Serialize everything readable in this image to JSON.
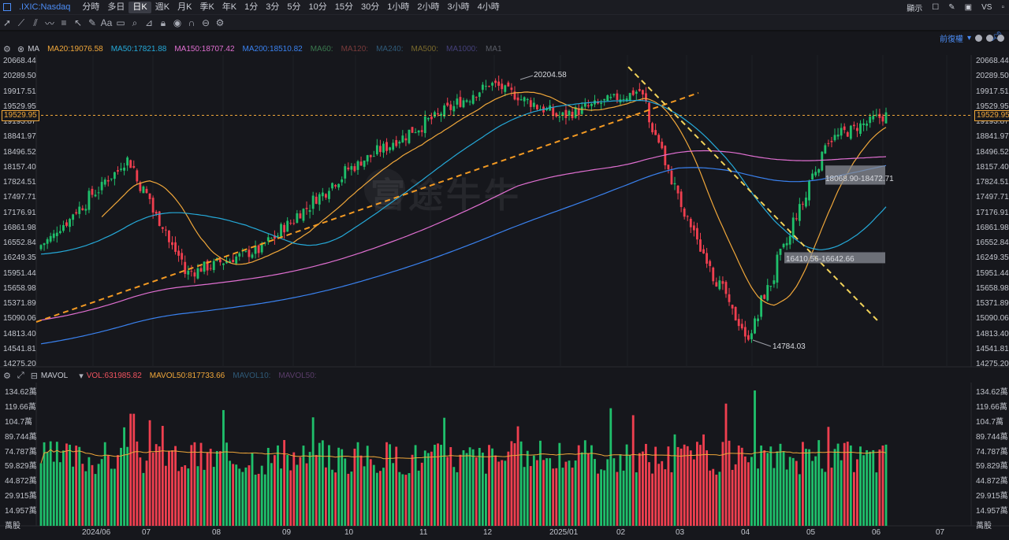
{
  "header": {
    "ticker": ".IXIC:Nasdaq",
    "timeframes": [
      "分時",
      "多日",
      "日K",
      "週K",
      "月K",
      "季K",
      "年K",
      "1分",
      "3分",
      "5分",
      "10分",
      "15分",
      "30分",
      "1小時",
      "2小時",
      "3小時",
      "4小時"
    ],
    "active_timeframe": "日K",
    "display_label": "顯示",
    "vs_label": "VS"
  },
  "main_chart": {
    "settings_label": "MA",
    "adjust_label": "前復權",
    "indicators": [
      {
        "label": "MA20:19076.58",
        "color": "#f0a73a"
      },
      {
        "label": "MA50:17821.88",
        "color": "#25a9d8"
      },
      {
        "label": "MA150:18707.42",
        "color": "#e06fd1"
      },
      {
        "label": "MA200:18510.82",
        "color": "#3a82f0"
      },
      {
        "label": "MA60:",
        "color": "#3b7a4f"
      },
      {
        "label": "MA120:",
        "color": "#7a3b3b"
      },
      {
        "label": "MA240:",
        "color": "#2f5a78"
      },
      {
        "label": "MA500:",
        "color": "#7a6a2c"
      },
      {
        "label": "MA1000:",
        "color": "#45407a"
      },
      {
        "label": "MA1",
        "color": "#5a5d66"
      }
    ],
    "price_axis": [
      "20668.44",
      "20289.50",
      "19917.51",
      "19529.95",
      "19193.87",
      "18841.97",
      "18496.52",
      "18157.40",
      "17824.51",
      "17497.71",
      "17176.91",
      "16861.98",
      "16552.84",
      "16249.35",
      "15951.44",
      "15658.98",
      "15371.89",
      "15090.06",
      "14813.40",
      "14541.81",
      "14275.20"
    ],
    "current_price": "19529.95",
    "annotations": {
      "high": "20204.58",
      "low": "14784.03",
      "zone_upper": "18068.90-18472.71",
      "zone_lower": "16410.56-16642.66"
    },
    "watermark": "富途牛牛"
  },
  "volume_chart": {
    "indicator_name": "MAVOL",
    "indicators": [
      {
        "label": "VOL:631985.82",
        "color": "#f0535f"
      },
      {
        "label": "MAVOL50:817733.66",
        "color": "#f0a73a"
      },
      {
        "label": "MAVOL10:",
        "color": "#2f5a78"
      },
      {
        "label": "MAVOL50:",
        "color": "#5a3d6a"
      }
    ],
    "axis": [
      "134.62萬",
      "119.66萬",
      "104.7萬",
      "89.744萬",
      "74.787萬",
      "59.829萬",
      "44.872萬",
      "29.915萬",
      "14.957萬",
      "萬股"
    ]
  },
  "x_axis": {
    "months": [
      "2024/06",
      "07",
      "08",
      "09",
      "10",
      "11",
      "12",
      "2025/01",
      "02",
      "03",
      "04",
      "05",
      "06",
      "07"
    ]
  },
  "colors": {
    "up": "#1fbf6b",
    "down": "#ef3f4f",
    "ma20": "#f0a73a",
    "ma50": "#25a9d8",
    "ma150": "#e06fd1",
    "ma200": "#3a82f0",
    "trendline": "#f39a23",
    "downtrend": "#f2d35a",
    "accent": "#4c8df6"
  },
  "chart_data": {
    "type": "candlestick",
    "title": ".IXIC:Nasdaq",
    "ylim": [
      14275.2,
      20668.44
    ],
    "key_points": [
      {
        "date": "2024-06-01",
        "close": 16700
      },
      {
        "date": "2024-07-10",
        "close": 18600
      },
      {
        "date": "2024-08-05",
        "close": 16200
      },
      {
        "date": "2024-09-06",
        "close": 16700
      },
      {
        "date": "2024-10-15",
        "close": 18400
      },
      {
        "date": "2024-12-16",
        "close": 20204.58
      },
      {
        "date": "2025-01-15",
        "close": 19500
      },
      {
        "date": "2025-02-19",
        "close": 20050
      },
      {
        "date": "2025-03-10",
        "close": 17500
      },
      {
        "date": "2025-04-07",
        "close": 14784.03
      },
      {
        "date": "2025-05-12",
        "close": 19000
      },
      {
        "date": "2025-06-06",
        "close": 19529.95
      }
    ]
  }
}
